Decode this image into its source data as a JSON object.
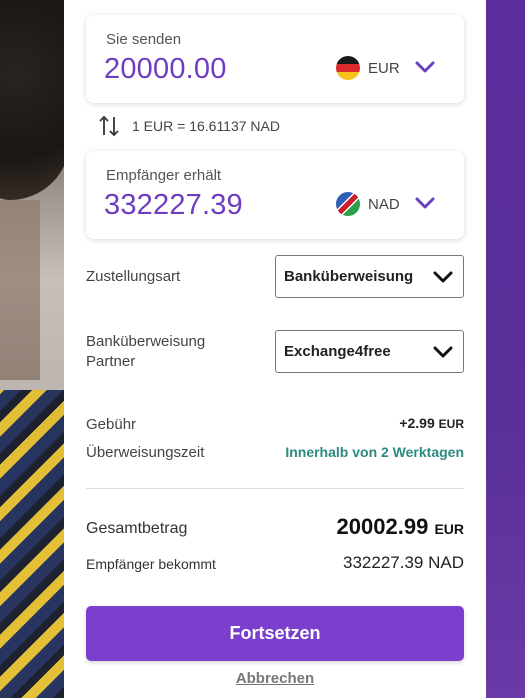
{
  "send": {
    "label": "Sie senden",
    "amount": "20000.00",
    "currency": "EUR",
    "flag_icon": "germany-flag-icon"
  },
  "rate": {
    "text": "1 EUR = 16.61137 NAD"
  },
  "receive": {
    "label": "Empfänger erhält",
    "amount": "332227.39",
    "currency": "NAD",
    "flag_icon": "namibia-flag-icon"
  },
  "delivery": {
    "label": "Zustellungsart",
    "selected": "Banküberweisung"
  },
  "partner": {
    "label": "Banküberweisung Partner",
    "selected": "Exchange4free"
  },
  "fee": {
    "label": "Gebühr",
    "value": "+2.99",
    "currency": "EUR"
  },
  "transfer_time": {
    "label": "Überweisungszeit",
    "value": "Innerhalb von 2 Werktagen"
  },
  "total": {
    "label": "Gesamtbetrag",
    "value": "20002.99",
    "currency": "EUR"
  },
  "recipient_gets": {
    "label": "Empfänger bekommt",
    "value": "332227.39 NAD"
  },
  "actions": {
    "continue": "Fortsetzen",
    "cancel": "Abbrechen"
  },
  "colors": {
    "accent": "#7b3fce",
    "amount": "#6d3fc0",
    "teal": "#2a8a7e",
    "band": "#5b2c9c"
  }
}
